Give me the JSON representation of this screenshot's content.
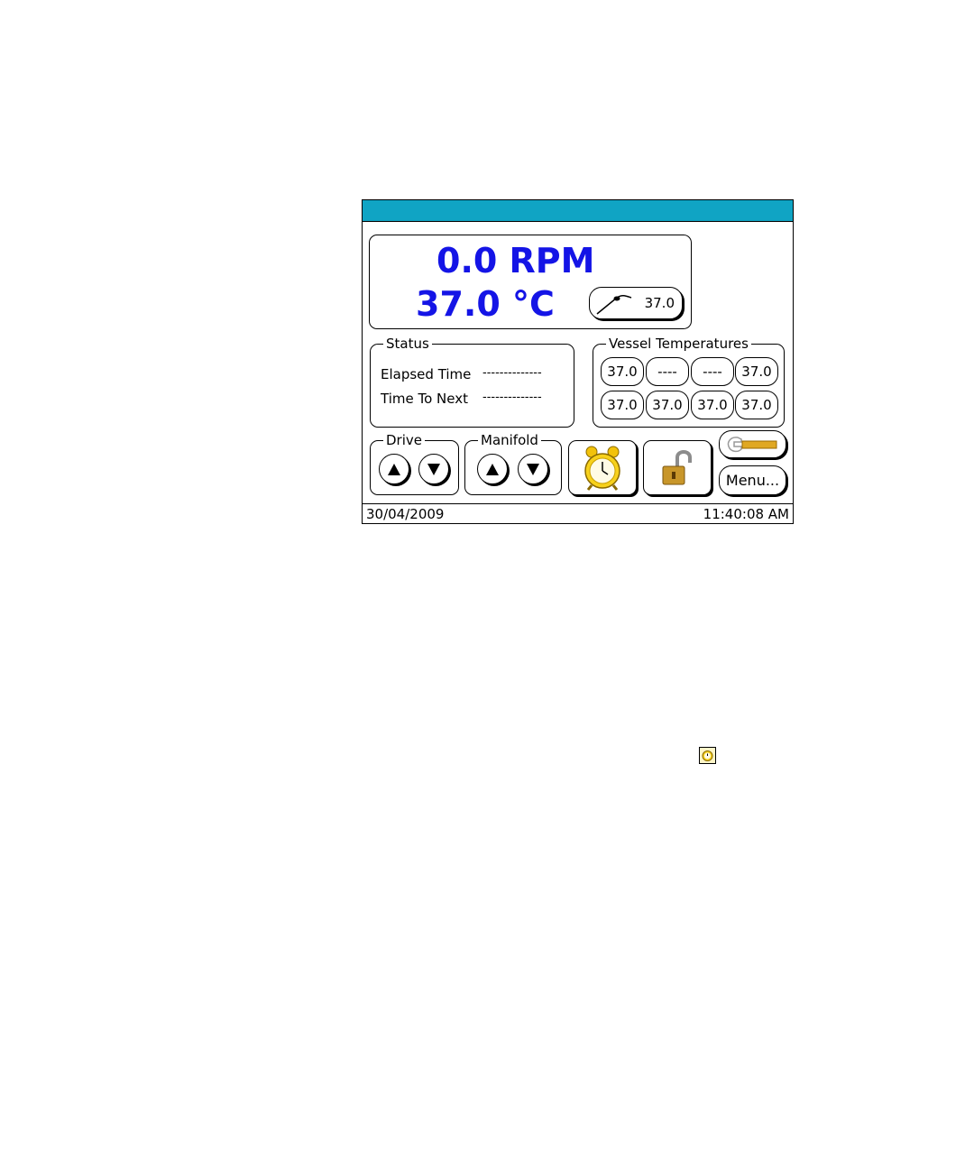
{
  "display": {
    "rpm": "0.0 RPM",
    "temperature": "37.0 °C",
    "probe_temp": "37.0"
  },
  "status": {
    "label": "Status",
    "rows": [
      {
        "name": "Elapsed Time",
        "value": "--------------"
      },
      {
        "name": "Time To Next",
        "value": "--------------"
      }
    ]
  },
  "vessels": {
    "label": "Vessel Temperatures",
    "row1": [
      "37.0",
      "----",
      "----",
      "37.0"
    ],
    "row2": [
      "37.0",
      "37.0",
      "37.0",
      "37.0"
    ]
  },
  "drive": {
    "label": "Drive"
  },
  "manifold": {
    "label": "Manifold"
  },
  "menu_label": "Menu...",
  "statusbar": {
    "date": "30/04/2009",
    "time": "11:40:08 AM"
  },
  "icons": {
    "alarm": "alarm-clock-icon",
    "lock": "padlock-open-icon",
    "tool": "wrench-icon",
    "probe": "probe-icon"
  },
  "colors": {
    "titlebar": "#10a4c4",
    "value_text": "#1414e6"
  }
}
